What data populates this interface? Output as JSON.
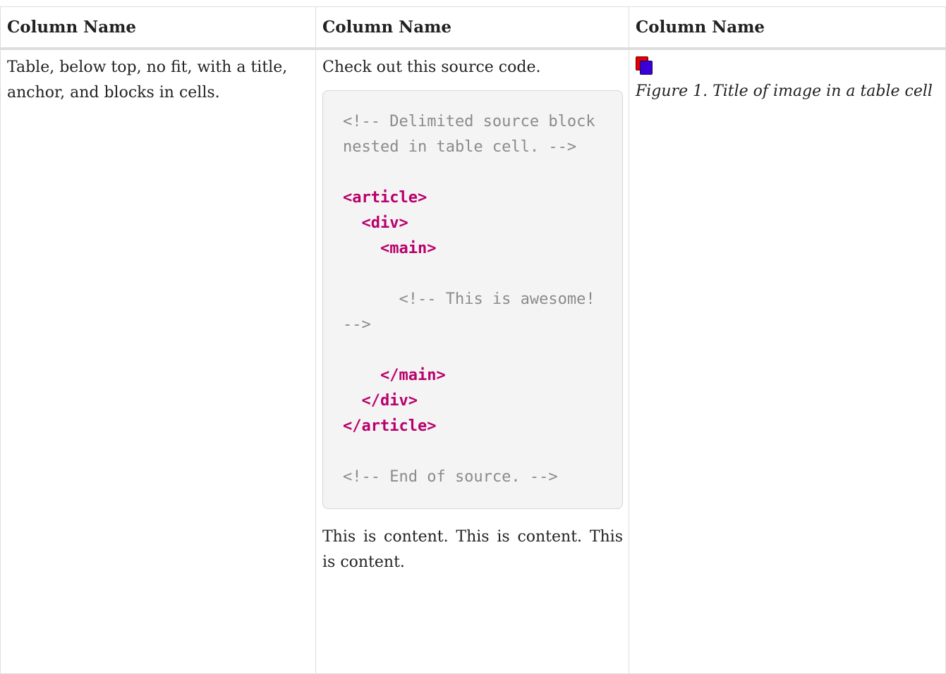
{
  "table": {
    "headers": [
      "Column Name",
      "Column Name",
      "Column Name"
    ],
    "row1": {
      "cell1": "Table, below top, no fit, with a title, anchor, and blocks in cells.",
      "cell2_intro": "Check out this source code.",
      "source_lines": [
        {
          "text": "<!-- Delimited source block nested in table cell. -->",
          "kind": "comment"
        },
        {
          "text": "",
          "kind": "blank"
        },
        {
          "text": "<article>",
          "kind": "tag"
        },
        {
          "text": "  <div>",
          "kind": "tag"
        },
        {
          "text": "    <main>",
          "kind": "tag"
        },
        {
          "text": "",
          "kind": "blank"
        },
        {
          "text": "      <!-- This is awesome! -->",
          "kind": "comment"
        },
        {
          "text": "",
          "kind": "blank"
        },
        {
          "text": "    </main>",
          "kind": "tag"
        },
        {
          "text": "  </div>",
          "kind": "tag"
        },
        {
          "text": "</article>",
          "kind": "tag"
        },
        {
          "text": "",
          "kind": "blank"
        },
        {
          "text": "<!-- End of source. -->",
          "kind": "comment"
        }
      ],
      "cell2_outro": "This is content. This is content. This is content.",
      "figure_caption": "Figure 1. Title of image in a table cell"
    }
  },
  "colors": {
    "tag": "#b8006c",
    "comment": "#8b8b8b",
    "border": "#dedede"
  }
}
